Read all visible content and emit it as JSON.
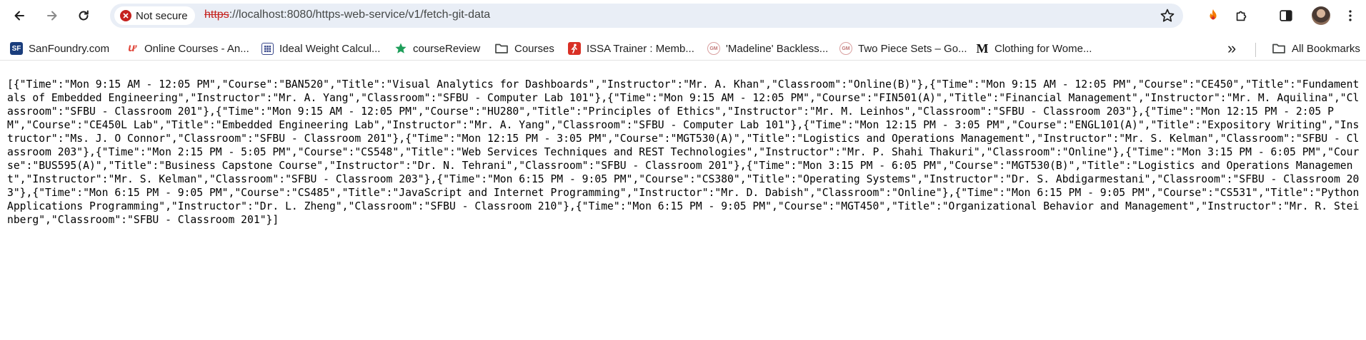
{
  "browser": {
    "security_label": "Not secure",
    "url_scheme": "https",
    "url_rest": "://localhost:8080/https-web-service/v1/fetch-git-data",
    "icons": {
      "back": "back-arrow-icon",
      "forward": "forward-arrow-icon",
      "reload": "reload-icon",
      "star": "star-icon",
      "extension_fire": "flame-extension-icon",
      "extensions": "puzzle-icon",
      "side_panel": "side-panel-icon",
      "menu": "kebab-menu-icon"
    }
  },
  "bookmarks": {
    "items": [
      {
        "label": "SanFoundry.com",
        "icon": "sanfoundry-icon",
        "color": "#1a3d7c"
      },
      {
        "label": "Online Courses - An...",
        "icon": "udemy-icon",
        "color": "#e0473b"
      },
      {
        "label": "Ideal Weight Calcul...",
        "icon": "calculator-icon",
        "color": "#3b4a8c"
      },
      {
        "label": "courseReview",
        "icon": "star-bookmark-icon",
        "color": "#1e9e5a"
      },
      {
        "label": "Courses",
        "icon": "folder-icon",
        "color": "#444746"
      },
      {
        "label": "ISSA Trainer : Memb...",
        "icon": "issa-icon",
        "color": "#d93025"
      },
      {
        "label": "'Madeline' Backless...",
        "icon": "gm-icon",
        "color": "#d9a0a0"
      },
      {
        "label": "Two Piece Sets – Go...",
        "icon": "gm-icon",
        "color": "#d9a0a0"
      },
      {
        "label": "Clothing for Wome...",
        "icon": "m-logo-icon",
        "color": "#111111"
      }
    ],
    "overflow_label": "»",
    "all_bookmarks": "All Bookmarks"
  },
  "page": {
    "json_text": "[{\"Time\":\"Mon 9:15 AM - 12:05 PM\",\"Course\":\"BAN520\",\"Title\":\"Visual Analytics for Dashboards\",\"Instructor\":\"Mr. A. Khan\",\"Classroom\":\"Online(B)\"},{\"Time\":\"Mon 9:15 AM - 12:05 PM\",\"Course\":\"CE450\",\"Title\":\"Fundamentals of Embedded Engineering\",\"Instructor\":\"Mr. A. Yang\",\"Classroom\":\"SFBU - Computer Lab 101\"},{\"Time\":\"Mon 9:15 AM - 12:05 PM\",\"Course\":\"FIN501(A)\",\"Title\":\"Financial Management\",\"Instructor\":\"Mr. M. Aquilina\",\"Classroom\":\"SFBU - Classroom 201\"},{\"Time\":\"Mon 9:15 AM - 12:05 PM\",\"Course\":\"HU280\",\"Title\":\"Principles of Ethics\",\"Instructor\":\"Mr. M. Leinhos\",\"Classroom\":\"SFBU - Classroom 203\"},{\"Time\":\"Mon 12:15 PM - 2:05 PM\",\"Course\":\"CE450L Lab\",\"Title\":\"Embedded Engineering Lab\",\"Instructor\":\"Mr. A. Yang\",\"Classroom\":\"SFBU - Computer Lab 101\"},{\"Time\":\"Mon 12:15 PM - 3:05 PM\",\"Course\":\"ENGL101(A)\",\"Title\":\"Expository Writing\",\"Instructor\":\"Ms. J. O Connor\",\"Classroom\":\"SFBU - Classroom 201\"},{\"Time\":\"Mon 12:15 PM - 3:05 PM\",\"Course\":\"MGT530(A)\",\"Title\":\"Logistics and Operations Management\",\"Instructor\":\"Mr. S. Kelman\",\"Classroom\":\"SFBU - Classroom 203\"},{\"Time\":\"Mon 2:15 PM - 5:05 PM\",\"Course\":\"CS548\",\"Title\":\"Web Services Techniques and REST Technologies\",\"Instructor\":\"Mr. P. Shahi Thakuri\",\"Classroom\":\"Online\"},{\"Time\":\"Mon 3:15 PM - 6:05 PM\",\"Course\":\"BUS595(A)\",\"Title\":\"Business Capstone Course\",\"Instructor\":\"Dr. N. Tehrani\",\"Classroom\":\"SFBU - Classroom 201\"},{\"Time\":\"Mon 3:15 PM - 6:05 PM\",\"Course\":\"MGT530(B)\",\"Title\":\"Logistics and Operations Management\",\"Instructor\":\"Mr. S. Kelman\",\"Classroom\":\"SFBU - Classroom 203\"},{\"Time\":\"Mon 6:15 PM - 9:05 PM\",\"Course\":\"CS380\",\"Title\":\"Operating Systems\",\"Instructor\":\"Dr. S. Abdigarmestani\",\"Classroom\":\"SFBU - Classroom 203\"},{\"Time\":\"Mon 6:15 PM - 9:05 PM\",\"Course\":\"CS485\",\"Title\":\"JavaScript and Internet Programming\",\"Instructor\":\"Mr. D. Dabish\",\"Classroom\":\"Online\"},{\"Time\":\"Mon 6:15 PM - 9:05 PM\",\"Course\":\"CS531\",\"Title\":\"Python Applications Programming\",\"Instructor\":\"Dr. L. Zheng\",\"Classroom\":\"SFBU - Classroom 210\"},{\"Time\":\"Mon 6:15 PM - 9:05 PM\",\"Course\":\"MGT450\",\"Title\":\"Organizational Behavior and Management\",\"Instructor\":\"Mr. R. Steinberg\",\"Classroom\":\"SFBU - Classroom 201\"}]"
  }
}
